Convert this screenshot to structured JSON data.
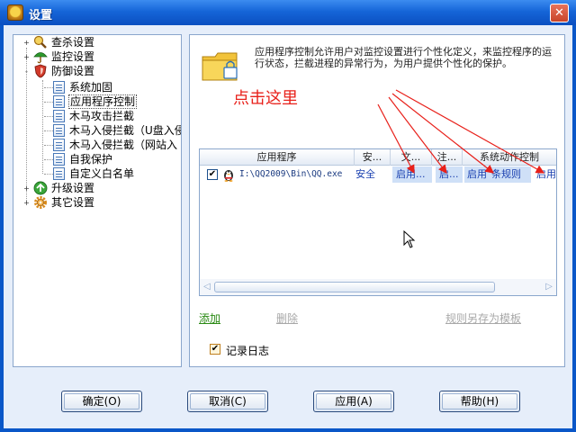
{
  "window": {
    "title": "设置",
    "close_glyph": "✕"
  },
  "tree": {
    "items": [
      {
        "label": "查杀设置",
        "icon": "magnifier-shield-icon",
        "expander": "+"
      },
      {
        "label": "监控设置",
        "icon": "umbrella-icon",
        "expander": "+"
      },
      {
        "label": "防御设置",
        "icon": "red-shield-icon",
        "expander": "-"
      },
      {
        "label": "系统加固",
        "icon": "document-icon"
      },
      {
        "label": "应用程序控制",
        "icon": "document-icon",
        "selected": true
      },
      {
        "label": "木马攻击拦截",
        "icon": "document-icon"
      },
      {
        "label": "木马入侵拦截（U盘入侵",
        "icon": "document-icon"
      },
      {
        "label": "木马入侵拦截（网站入",
        "icon": "document-icon"
      },
      {
        "label": "自我保护",
        "icon": "document-icon"
      },
      {
        "label": "自定义白名单",
        "icon": "document-icon"
      },
      {
        "label": "升级设置",
        "icon": "green-arrow-icon",
        "expander": "+"
      },
      {
        "label": "其它设置",
        "icon": "gear-icon",
        "expander": "+"
      }
    ]
  },
  "main": {
    "description": "应用程序控制允许用户对监控设置进行个性化定义，来监控程序的运行状态，拦截进程的异常行为，为用户提供个性化的保护。",
    "annotation": "点击这里",
    "grid": {
      "columns": [
        "应用程序",
        "安...",
        "文...",
        "注...",
        "系统动作控制"
      ],
      "rows": [
        {
          "checked": true,
          "app": "I:\\QQ2009\\Bin\\QQ.exe",
          "safety": "安全",
          "c1": "启用...",
          "c2": "启...",
          "c3": "启用",
          "c4": "条规则",
          "c5": "启用"
        }
      ]
    },
    "links": {
      "add": "添加",
      "delete": "删除",
      "save_template": "规则另存为模板"
    },
    "log_checkbox": {
      "label": "记录日志",
      "checked": true
    }
  },
  "buttons": {
    "ok": "确定(O)",
    "cancel": "取消(C)",
    "apply": "应用(A)",
    "help": "帮助(H)"
  },
  "colors": {
    "annotation": "#e8201a",
    "title_bar": "#1565d8",
    "panel_border": "#8aa6cc"
  }
}
